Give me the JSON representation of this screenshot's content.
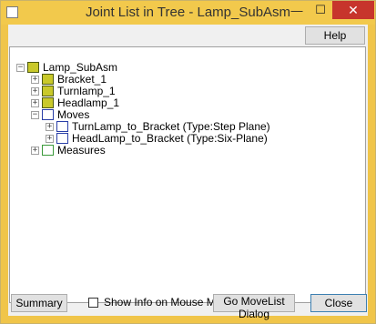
{
  "window": {
    "title": "Joint List in Tree - Lamp_SubAsm",
    "minimize_glyph": "—",
    "maximize_glyph": "☐",
    "close_glyph": "✕"
  },
  "toolbar": {
    "help_label": "Help"
  },
  "tree": {
    "root": {
      "label": "Lamp_SubAsm",
      "expander": "−",
      "icon": "part-icon"
    },
    "items": [
      {
        "label": "Bracket_1",
        "expander": "+",
        "icon": "part-icon"
      },
      {
        "label": "Turnlamp_1",
        "expander": "+",
        "icon": "part-icon"
      },
      {
        "label": "Headlamp_1",
        "expander": "+",
        "icon": "part-icon"
      },
      {
        "label": "Moves",
        "expander": "−",
        "icon": "moves-icon",
        "children": [
          {
            "label": "TurnLamp_to_Bracket (Type:Step Plane)",
            "expander": "+",
            "icon": "joint-icon"
          },
          {
            "label": "HeadLamp_to_Bracket (Type:Six-Plane)",
            "expander": "+",
            "icon": "joint-icon"
          }
        ]
      },
      {
        "label": "Measures",
        "expander": "+",
        "icon": "measures-icon"
      }
    ]
  },
  "footer": {
    "summary_label": "Summary",
    "show_info_label": "Show Info on Mouse Move",
    "show_info_checked": false,
    "go_movelist_label": "Go MoveList Dialog",
    "close_label": "Close"
  }
}
